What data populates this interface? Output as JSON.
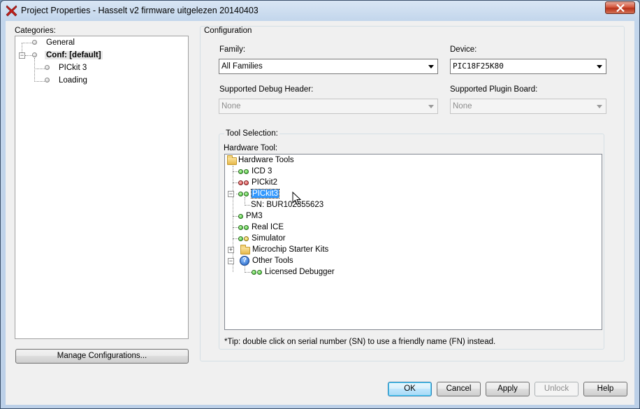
{
  "window": {
    "title": "Project Properties - Hasselt v2 firmware uitgelezen 20140403",
    "close_glyph": "x"
  },
  "categories": {
    "label": "Categories:",
    "items": [
      {
        "label": "General"
      },
      {
        "label": "Conf: [default]"
      },
      {
        "label": "PICkit 3"
      },
      {
        "label": "Loading"
      }
    ],
    "manage_button": "Manage Configurations..."
  },
  "configuration": {
    "legend": "Configuration",
    "family_label": "Family:",
    "family_value": "All Families",
    "device_label": "Device:",
    "device_value": "PIC18F25K80",
    "debug_header_label": "Supported Debug Header:",
    "debug_header_value": "None",
    "plugin_board_label": "Supported Plugin Board:",
    "plugin_board_value": "None"
  },
  "tool_selection": {
    "legend": "Tool Selection:",
    "hw_label": "Hardware Tool:",
    "root": "Hardware Tools",
    "tools": [
      {
        "label": "ICD 3",
        "status": "green-green"
      },
      {
        "label": "PICkit2",
        "status": "red-red"
      },
      {
        "label": "PICkit3",
        "status": "green-green",
        "selected": true
      },
      {
        "label": "SN: BUR102355623"
      },
      {
        "label": "PM3",
        "status": "green"
      },
      {
        "label": "Real ICE",
        "status": "green-green"
      },
      {
        "label": "Simulator",
        "status": "green-yellow"
      },
      {
        "label": "Microchip Starter Kits"
      },
      {
        "label": "Other Tools"
      },
      {
        "label": "Licensed Debugger",
        "status": "green-green"
      }
    ],
    "tip": "*Tip: double click on serial number (SN) to use a friendly name (FN) instead."
  },
  "buttons": {
    "ok": "OK",
    "cancel": "Cancel",
    "apply": "Apply",
    "unlock": "Unlock",
    "help": "Help"
  },
  "colors": {
    "selection": "#3399ff",
    "close_button": "#c8442c",
    "status_green": "#2fb52a",
    "status_red": "#d23434",
    "status_yellow": "#e3c21c"
  }
}
